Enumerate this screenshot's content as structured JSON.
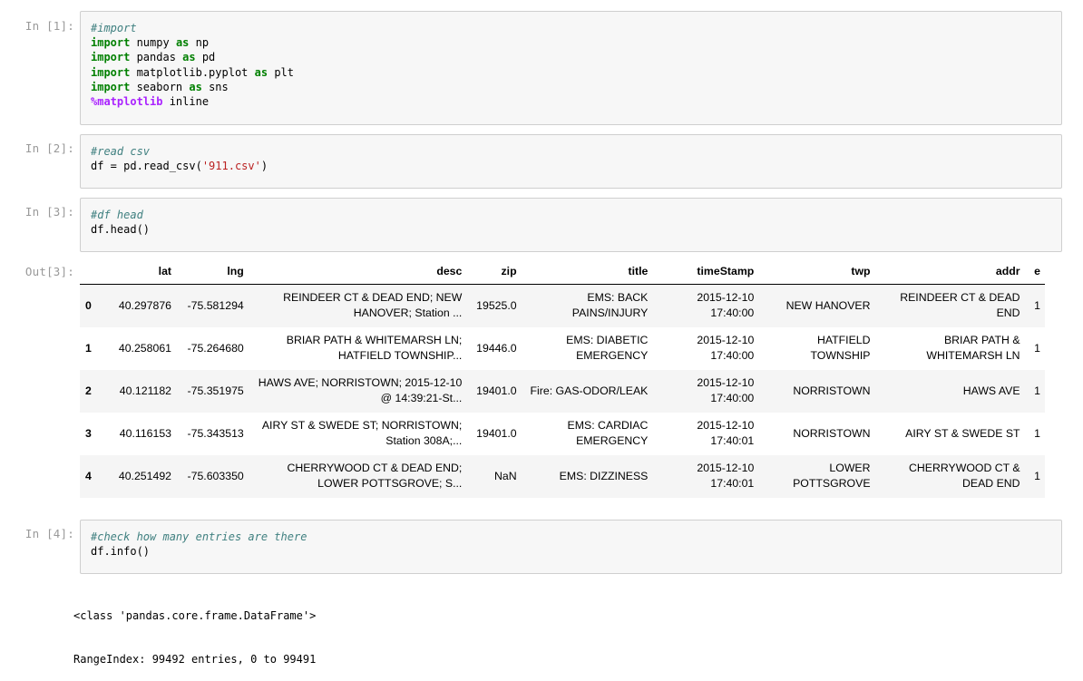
{
  "cells": [
    {
      "prompt": "In [1]:",
      "lines": [
        [
          {
            "t": "cm",
            "v": "#import"
          }
        ],
        [
          {
            "t": "kw",
            "v": "import"
          },
          {
            "t": "op",
            "v": " numpy "
          },
          {
            "t": "kw",
            "v": "as"
          },
          {
            "t": "op",
            "v": " np"
          }
        ],
        [
          {
            "t": "kw",
            "v": "import"
          },
          {
            "t": "op",
            "v": " pandas "
          },
          {
            "t": "kw",
            "v": "as"
          },
          {
            "t": "op",
            "v": " pd"
          }
        ],
        [
          {
            "t": "kw",
            "v": "import"
          },
          {
            "t": "op",
            "v": " matplotlib.pyplot "
          },
          {
            "t": "kw",
            "v": "as"
          },
          {
            "t": "op",
            "v": " plt"
          }
        ],
        [
          {
            "t": "kw",
            "v": "import"
          },
          {
            "t": "op",
            "v": " seaborn "
          },
          {
            "t": "kw",
            "v": "as"
          },
          {
            "t": "op",
            "v": " sns"
          }
        ],
        [
          {
            "t": "mg",
            "v": "%matplotlib"
          },
          {
            "t": "op",
            "v": " inline"
          }
        ]
      ]
    },
    {
      "prompt": "In [2]:",
      "lines": [
        [
          {
            "t": "cm",
            "v": "#read csv"
          }
        ],
        [
          {
            "t": "op",
            "v": "df = pd.read_csv("
          },
          {
            "t": "st",
            "v": "'911.csv'"
          },
          {
            "t": "op",
            "v": ")"
          }
        ]
      ]
    },
    {
      "prompt": "In [3]:",
      "lines": [
        [
          {
            "t": "cm",
            "v": "#df head"
          }
        ],
        [
          {
            "t": "op",
            "v": "df.head()"
          }
        ]
      ]
    },
    {
      "prompt": "In [4]:",
      "lines": [
        [
          {
            "t": "cm",
            "v": "#check how many entries are there"
          }
        ],
        [
          {
            "t": "op",
            "v": "df.info()"
          }
        ]
      ]
    }
  ],
  "out3": {
    "prompt": "Out[3]:",
    "columns": [
      "",
      "lat",
      "lng",
      "desc",
      "zip",
      "title",
      "timeStamp",
      "twp",
      "addr",
      "e"
    ],
    "rows": [
      [
        "0",
        "40.297876",
        "-75.581294",
        "REINDEER CT & DEAD END; NEW HANOVER; Station ...",
        "19525.0",
        "EMS: BACK PAINS/INJURY",
        "2015-12-10 17:40:00",
        "NEW HANOVER",
        "REINDEER CT & DEAD END",
        "1"
      ],
      [
        "1",
        "40.258061",
        "-75.264680",
        "BRIAR PATH & WHITEMARSH LN; HATFIELD TOWNSHIP...",
        "19446.0",
        "EMS: DIABETIC EMERGENCY",
        "2015-12-10 17:40:00",
        "HATFIELD TOWNSHIP",
        "BRIAR PATH & WHITEMARSH LN",
        "1"
      ],
      [
        "2",
        "40.121182",
        "-75.351975",
        "HAWS AVE; NORRISTOWN; 2015-12-10 @ 14:39:21-St...",
        "19401.0",
        "Fire: GAS-ODOR/LEAK",
        "2015-12-10 17:40:00",
        "NORRISTOWN",
        "HAWS AVE",
        "1"
      ],
      [
        "3",
        "40.116153",
        "-75.343513",
        "AIRY ST & SWEDE ST; NORRISTOWN; Station 308A;...",
        "19401.0",
        "EMS: CARDIAC EMERGENCY",
        "2015-12-10 17:40:01",
        "NORRISTOWN",
        "AIRY ST & SWEDE ST",
        "1"
      ],
      [
        "4",
        "40.251492",
        "-75.603350",
        "CHERRYWOOD CT & DEAD END; LOWER POTTSGROVE; S...",
        "NaN",
        "EMS: DIZZINESS",
        "2015-12-10 17:40:01",
        "LOWER POTTSGROVE",
        "CHERRYWOOD CT & DEAD END",
        "1"
      ]
    ]
  },
  "out4": {
    "lines": [
      "<class 'pandas.core.frame.DataFrame'>",
      "RangeIndex: 99492 entries, 0 to 99491"
    ]
  }
}
